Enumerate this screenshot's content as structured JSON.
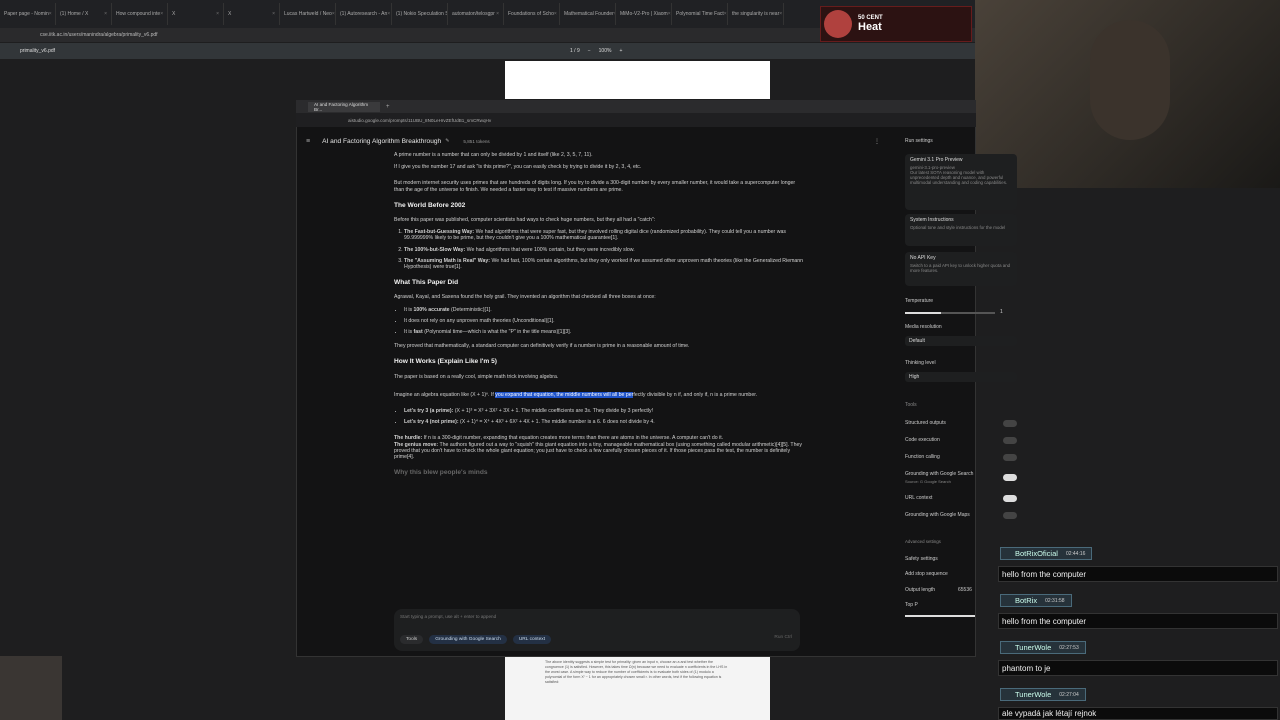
{
  "browser": {
    "tabs": [
      "Paper page - Nomin",
      "(1) Home / X",
      "How compound inte",
      "X",
      "X",
      "Lucas Hartweld / Neo",
      "(1) Autoresearch - An",
      "(1) Nokio Speculation S",
      "automaton/telosgpr",
      "Foundations of Scho",
      "Mathematical Founder",
      "MiMo-V2-Pro | Xiaom",
      "Polynomial Time Fact",
      "the singularity is near"
    ],
    "url": "cse.iitk.ac.in/users/manindra/algebra/primality_v6.pdf",
    "pdf_name": "primality_v6.pdf",
    "pdf_page": "1 / 9",
    "pdf_zoom": "100%"
  },
  "alert": {
    "name": "50 CENT",
    "song": "Heat"
  },
  "studio": {
    "tab_label": "AI and Factoring Algorithm Br...",
    "url": "aistudio.google.com/prompts/11UBU_8N0LeHrvZEfUdB1_smCRwqHv",
    "title": "AI and Factoring Algorithm Breakthrough",
    "tokens": "5,851 tokens",
    "body": {
      "p1": "A prime number is a number that can only be divided by 1 and itself (like 2, 3, 5, 7, 11).",
      "p2": "If I give you the number 17 and ask \"is this prime?\", you can easily check by trying to divide it by 2, 3, 4, etc.",
      "p3": "But modern internet security uses primes that are hundreds of digits long. If you try to divide a 300-digit number by every smaller number, it would take a supercomputer longer than the age of the universe to finish. We needed a faster way to test if massive numbers are prime.",
      "h1": "The World Before 2002",
      "p4": "Before this paper was published, computer scientists had ways to check huge numbers, but they all had a \"catch\":",
      "ol": [
        {
          "b": "The Fast-but-Guessing Way:",
          "t": " We had algorithms that were super fast, but they involved rolling digital dice (randomized probability). They could tell you a number was 99.999999% likely to be prime, but they couldn't give you a 100% mathematical guarantee[1]."
        },
        {
          "b": "The 100%-but-Slow Way:",
          "t": " We had algorithms that were 100% certain, but they were incredibly slow."
        },
        {
          "b": "The \"Assuming Math is Real\" Way:",
          "t": " We had fast, 100% certain algorithms, but they only worked if we assumed other unproven math theories (like the Generalized Riemann Hypothesis) were true[1]."
        }
      ],
      "h2": "What This Paper Did",
      "p5": "Agrawal, Kayal, and Saxena found the holy grail. They invented an algorithm that checked all three boxes at once:",
      "ul": [
        {
          "pre": "It is ",
          "b": "100% accurate",
          "t": " (Deterministic)[1]."
        },
        {
          "pre": "It does not rely on any unproven math theories (Unconditional)[1].",
          "b": "",
          "t": ""
        },
        {
          "pre": "It is ",
          "b": "fast",
          "t": " (Polynomial time—which is what the \"P\" in the title means)[1][3]."
        }
      ],
      "p6": "They proved that mathematically, a standard computer can definitively verify if a number is prime in a reasonable amount of time.",
      "h3": "How It Works (Explain Like I'm 5)",
      "p7": "The paper is based on a really cool, simple math trick involving algebra.",
      "p8a": "Imagine an algebra equation like (X + 1)ⁿ. If ",
      "p8sel": "you expand that equation, the middle numbers will all be per",
      "p8b": "fectly divisible by n if, and only if, n is a prime number.",
      "ex1b": "Let's try 3 (a prime):",
      "ex1": " (X + 1)³ = X³ + 3X² + 3X + 1. The middle coefficients are 3s. They divide by 3 perfectly!",
      "ex2b": "Let's try 4 (not prime):",
      "ex2": " (X + 1)⁴ = X⁴ + 4X³ + 6X² + 4X + 1. The middle number is a 6. 6 does not divide by 4.",
      "hurdle_b": "The hurdle:",
      "hurdle": " If n is a 300-digit number, expanding that equation creates more terms than there are atoms in the universe. A computer can't do it.",
      "genius_b": "The genius move:",
      "genius": " The authors figured out a way to \"squish\" this giant equation into a tiny, manageable mathematical box (using something called modular arithmetic)[4][5]. They proved that you don't have to check the whole giant equation; you just have to check a few carefully chosen pieces of it. If those pieces pass the test, the number is definitely prime[4].",
      "h4": "Why this blew people's minds"
    },
    "prompt": {
      "placeholder": "Start typing a prompt, use alt + enter to append",
      "tools": "Tools",
      "chip1": "Grounding with Google Search",
      "chip2": "URL context",
      "run": "Run Ctrl"
    },
    "settings": {
      "header": "Run settings",
      "model_name": "Gemini 3.1 Pro Preview",
      "model_id": "gemini-3.1-pro-preview",
      "model_desc": "Our latest SOTA reasoning model with unprecedented depth and nuance, and powerful multimodal understanding and coding capabilities.",
      "sys_title": "System Instructions",
      "sys_desc": "Optional tone and style instructions for the model",
      "api_title": "No API Key",
      "api_desc": "Switch to a paid API key to unlock higher quota and more features.",
      "temperature_label": "Temperature",
      "temperature_value": "1",
      "media_label": "Media resolution",
      "media_value": "Default",
      "thinking_label": "Thinking level",
      "thinking_value": "High",
      "tools_label": "Tools",
      "structured": "Structured outputs",
      "code": "Code execution",
      "function": "Function calling",
      "grounding": "Grounding with Google Search",
      "grounding_source": "Source: G Google Search",
      "urlctx": "URL context",
      "maps": "Grounding with Google Maps",
      "advanced": "Advanced settings",
      "safety": "Safety settings",
      "stop": "Add stop sequence",
      "output_label": "Output length",
      "output_value": "65536",
      "topp": "Top P"
    }
  },
  "chat": [
    {
      "name": "BotRixOficial",
      "time": "02:44:16",
      "msg": "hello from the computer"
    },
    {
      "name": "BotRix",
      "time": "02:31:58",
      "msg": "hello from the computer"
    },
    {
      "name": "TunerWole",
      "time": "02:27:53",
      "msg": "phantom to je"
    },
    {
      "name": "TunerWole",
      "time": "02:27:04",
      "msg": "ale vypadá jak létají rejnok"
    }
  ],
  "pdf_snippet": "The above identity suggests a simple test for primality: given an input n, choose an a and test whether the congruence (1) is satisfied. However, this takes time Ω(n) because we need to evaluate n coefficients in the LHS in the worst case. A simple way to reduce the number of coefficients is to evaluate both sides of (1) modulo a polynomial of the form Xʳ − 1 for an appropriately chosen small r. In other words, test if the following equation is satisfied:"
}
